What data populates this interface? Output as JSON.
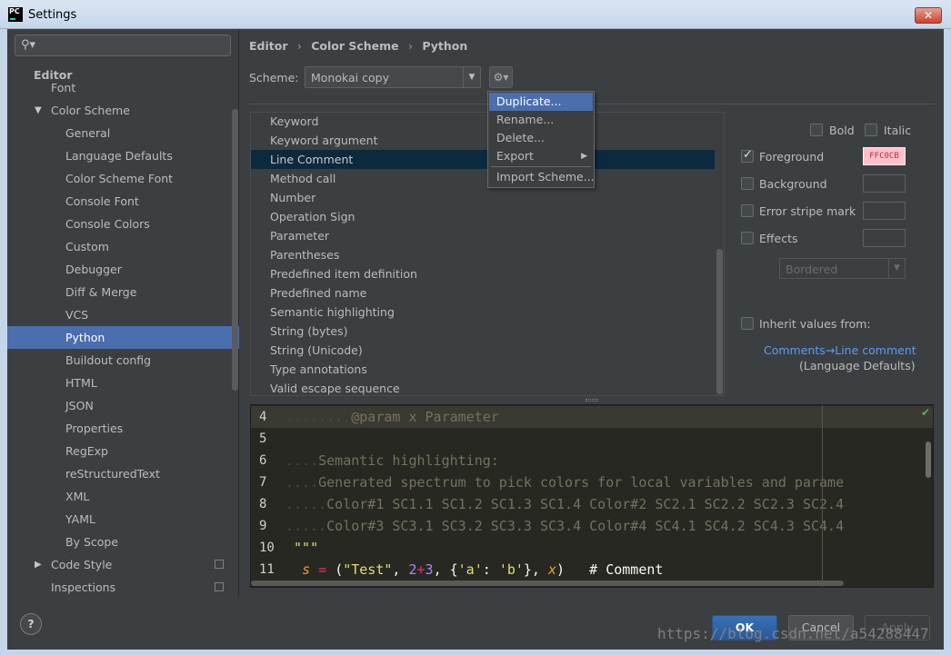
{
  "window": {
    "title": "Settings",
    "app_icon_text": "PC",
    "close_glyph": "✕"
  },
  "search": {
    "icon": "search-icon",
    "value": ""
  },
  "sidebar": {
    "items": [
      {
        "label": "Editor",
        "level": 0,
        "bold": true
      },
      {
        "label": "Font",
        "level": 1
      },
      {
        "label": "Color Scheme",
        "level": 1,
        "expanded": true
      },
      {
        "label": "General",
        "level": 2
      },
      {
        "label": "Language Defaults",
        "level": 2
      },
      {
        "label": "Color Scheme Font",
        "level": 2
      },
      {
        "label": "Console Font",
        "level": 2
      },
      {
        "label": "Console Colors",
        "level": 2
      },
      {
        "label": "Custom",
        "level": 2
      },
      {
        "label": "Debugger",
        "level": 2
      },
      {
        "label": "Diff & Merge",
        "level": 2
      },
      {
        "label": "VCS",
        "level": 2
      },
      {
        "label": "Python",
        "level": 2,
        "selected": true
      },
      {
        "label": "Buildout config",
        "level": 2
      },
      {
        "label": "HTML",
        "level": 2
      },
      {
        "label": "JSON",
        "level": 2
      },
      {
        "label": "Properties",
        "level": 2
      },
      {
        "label": "RegExp",
        "level": 2
      },
      {
        "label": "reStructuredText",
        "level": 2
      },
      {
        "label": "XML",
        "level": 2
      },
      {
        "label": "YAML",
        "level": 2
      },
      {
        "label": "By Scope",
        "level": 2
      },
      {
        "label": "Code Style",
        "level": 1,
        "collapsed": true
      },
      {
        "label": "Inspections",
        "level": 1
      }
    ]
  },
  "breadcrumb": [
    "Editor",
    "Color Scheme",
    "Python"
  ],
  "scheme": {
    "label": "Scheme:",
    "value": "Monokai copy"
  },
  "gear_menu": {
    "items": [
      "Duplicate...",
      "Rename...",
      "Delete...",
      "Export",
      "Import Scheme..."
    ],
    "selected": "Duplicate..."
  },
  "elements": [
    "Keyword",
    "Keyword argument",
    "Line Comment",
    "Method call",
    "Number",
    "Operation Sign",
    "Parameter",
    "Parentheses",
    "Predefined item definition",
    "Predefined name",
    "Semantic highlighting",
    "String (bytes)",
    "String (Unicode)",
    "Type annotations",
    "Valid escape sequence"
  ],
  "selected_element": "Line Comment",
  "attributes": {
    "bold": {
      "label": "Bold",
      "checked": false
    },
    "italic": {
      "label": "Italic",
      "checked": false
    },
    "foreground": {
      "label": "Foreground",
      "checked": true,
      "color": "FFC0CB"
    },
    "background": {
      "label": "Background",
      "checked": false
    },
    "error_stripe": {
      "label": "Error stripe mark",
      "checked": false
    },
    "effects": {
      "label": "Effects",
      "checked": false,
      "style": "Bordered"
    },
    "inherit": {
      "label": "Inherit values from:",
      "checked": false
    },
    "inherit_link": "Comments→Line comment",
    "inherit_source": "(Language Defaults)"
  },
  "preview": {
    "lines": [
      {
        "n": "4",
        "text": "        @param x Parameter"
      },
      {
        "n": "5",
        "text": ""
      },
      {
        "n": "6",
        "text": "    Semantic highlighting:"
      },
      {
        "n": "7",
        "text": "    Generated spectrum to pick colors for local variables and parame"
      },
      {
        "n": "8",
        "text": "     Color#1 SC1.1 SC1.2 SC1.3 SC1.4 Color#2 SC2.1 SC2.2 SC2.3 SC2.4"
      },
      {
        "n": "9",
        "text": "     Color#3 SC3.1 SC3.2 SC3.3 SC3.4 Color#4 SC4.1 SC4.2 SC4.3 SC4.4"
      },
      {
        "n": "10",
        "text": "\"\"\""
      },
      {
        "n": "11",
        "text": "s = (\"Test\", 2+3, {'a': 'b'}, x)   # Comment"
      }
    ]
  },
  "buttons": {
    "ok": "OK",
    "cancel": "Cancel",
    "apply": "Apply",
    "help": "?"
  },
  "watermark": "https://blog.csdn.net/a54288447",
  "colors": {
    "selection": "#4b6eaf",
    "background": "#3c3f41",
    "editor_bg": "#272822",
    "link": "#589df6",
    "foreground_swatch": "#ffc0cb"
  }
}
